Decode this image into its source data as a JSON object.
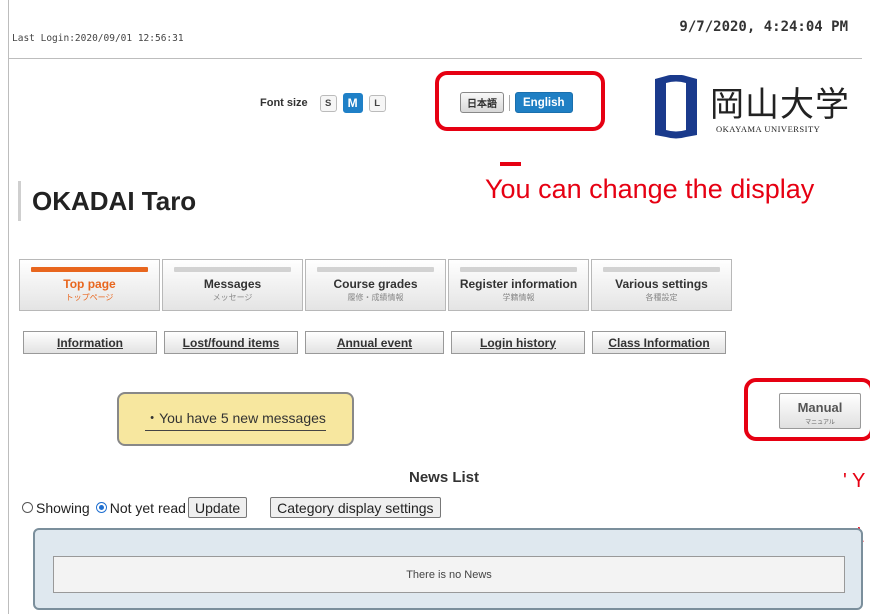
{
  "header": {
    "last_login": "Last Login:2020/09/01 12:56:31",
    "clock": "9/7/2020, 4:24:04 PM"
  },
  "font_size": {
    "label": "Font size",
    "options": [
      "S",
      "M",
      "L"
    ],
    "selected": "M"
  },
  "language": {
    "japanese": "日本語",
    "english": "English",
    "selected": "English"
  },
  "logo": {
    "jp": "岡山大学",
    "en": "OKAYAMA UNIVERSITY"
  },
  "annotations": {
    "lang_note": "You can change the display",
    "fragment1": "' Y",
    "fragment2": "\\"
  },
  "user": {
    "name": "OKADAI Taro"
  },
  "main_tabs": [
    {
      "label": "Top page",
      "sub": "トップページ",
      "active": true
    },
    {
      "label": "Messages",
      "sub": "メッセージ"
    },
    {
      "label": "Course grades",
      "sub": "履修・成績情報"
    },
    {
      "label": "Register information",
      "sub": "学籍情報"
    },
    {
      "label": "Various settings",
      "sub": "各種設定"
    }
  ],
  "sub_tabs": [
    "Information",
    "Lost/found items",
    "Annual event",
    "Login history",
    "Class Information"
  ],
  "messages": {
    "text": "・You have  5 new messages"
  },
  "manual": {
    "label": "Manual",
    "sub": "マニュアル"
  },
  "news": {
    "title": "News List",
    "radio_showing": "Showing",
    "radio_not_read": "Not yet read",
    "selected": "Not yet read",
    "update_button": "Update",
    "category_button": "Category display settings",
    "empty_message": "There is no News"
  },
  "colors": {
    "accent_blue": "#1f7fc4",
    "active_tab_orange": "#e8661e",
    "annotation_red": "#e60012",
    "message_yellow": "#f7e79f"
  }
}
